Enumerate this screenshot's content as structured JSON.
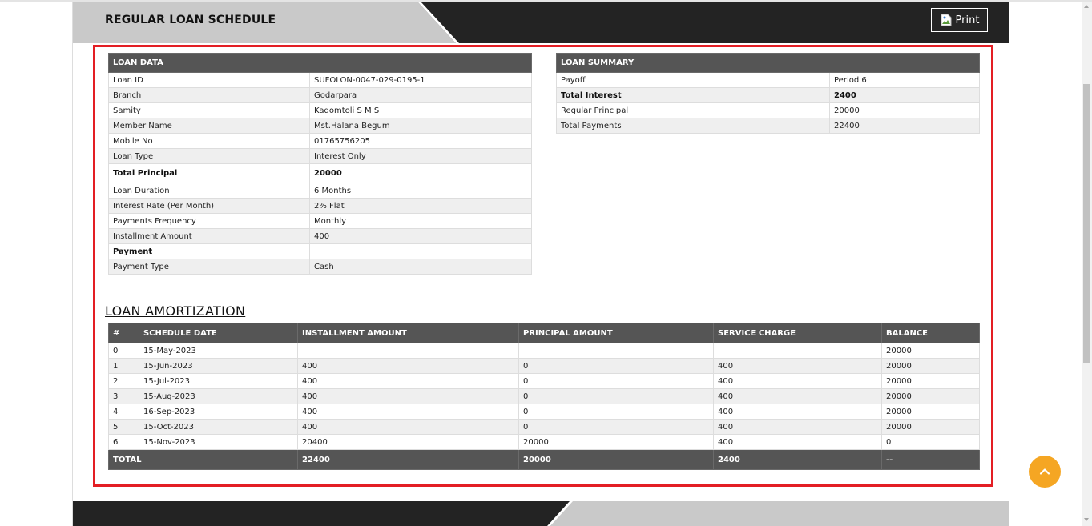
{
  "header": {
    "title": "REGULAR LOAN SCHEDULE",
    "print_label": "Print"
  },
  "loan_data": {
    "heading": "LOAN DATA",
    "rows": [
      {
        "label": "Loan ID",
        "value": "SUFOLON-0047-029-0195-1"
      },
      {
        "label": "Branch",
        "value": "Godarpara"
      },
      {
        "label": "Samity",
        "value": "Kadomtoli S M S"
      },
      {
        "label": "Member Name",
        "value": "Mst.Halana Begum"
      },
      {
        "label": "Mobile No",
        "value": "01765756205"
      },
      {
        "label": "Loan Type",
        "value": "Interest Only"
      },
      {
        "label": "Total Principal",
        "value": "20000"
      },
      {
        "label": "Loan Duration",
        "value": "6 Months"
      },
      {
        "label": "Interest Rate (Per Month)",
        "value": "2% Flat"
      },
      {
        "label": "Payments Frequency",
        "value": "Monthly"
      },
      {
        "label": "Installment Amount",
        "value": "400"
      },
      {
        "label": "Payment",
        "value": ""
      },
      {
        "label": "Payment Type",
        "value": "Cash"
      }
    ]
  },
  "loan_summary": {
    "heading": "LOAN SUMMARY",
    "rows": [
      {
        "label": "Payoff",
        "value": "Period 6"
      },
      {
        "label": "Total Interest",
        "value": "2400"
      },
      {
        "label": "Regular Principal",
        "value": "20000"
      },
      {
        "label": "Total Payments",
        "value": "22400"
      }
    ]
  },
  "amortization": {
    "title": "LOAN AMORTIZATION",
    "columns": [
      "#",
      "SCHEDULE DATE",
      "INSTALLMENT AMOUNT",
      "PRINCIPAL AMOUNT",
      "SERVICE CHARGE",
      "BALANCE"
    ],
    "rows": [
      [
        "0",
        "15-May-2023",
        "",
        "",
        "",
        "20000"
      ],
      [
        "1",
        "15-Jun-2023",
        "400",
        "0",
        "400",
        "20000"
      ],
      [
        "2",
        "15-Jul-2023",
        "400",
        "0",
        "400",
        "20000"
      ],
      [
        "3",
        "15-Aug-2023",
        "400",
        "0",
        "400",
        "20000"
      ],
      [
        "4",
        "16-Sep-2023",
        "400",
        "0",
        "400",
        "20000"
      ],
      [
        "5",
        "15-Oct-2023",
        "400",
        "0",
        "400",
        "20000"
      ],
      [
        "6",
        "15-Nov-2023",
        "20400",
        "20000",
        "400",
        "0"
      ]
    ],
    "total": [
      "TOTAL",
      "22400",
      "20000",
      "2400",
      "--"
    ]
  },
  "icons": {
    "print": "broken-image-icon",
    "scroll_top": "chevron-up-icon"
  },
  "colors": {
    "header_dark": "#232323",
    "header_light": "#c9c9c9",
    "table_header": "#555555",
    "highlight_frame": "#e31e24",
    "scroll_top_button": "#f5a623"
  }
}
